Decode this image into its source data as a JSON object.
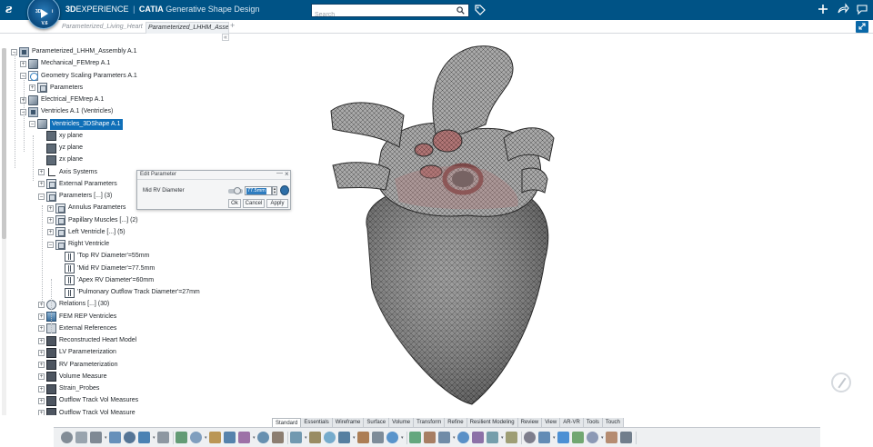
{
  "titlebar": {
    "brand_prefix": "3D",
    "brand_rest": "EXPERIENCE",
    "separator": "|",
    "product": "CATIA",
    "app": "Generative Shape Design",
    "compass_version": "V.6",
    "compass_quadrants": [
      "3D",
      "i"
    ],
    "search_placeholder": "Search",
    "colors": {
      "bar": "#005386",
      "accent": "#0a68a8"
    }
  },
  "tabs": {
    "items": [
      {
        "label": "Parameterized_Living_Heart"
      },
      {
        "label": "Parameterized_LHHM_Assembly"
      }
    ],
    "add_symbol": "+",
    "collapse_symbol": "«"
  },
  "tree": {
    "rows": [
      {
        "label": "Parameterized_LHHM_Assembly A.1",
        "exp": "−",
        "icon": "product-icon"
      },
      {
        "label": "Mechanical_FEMrep A.1",
        "exp": "+",
        "icon": "part-icon"
      },
      {
        "label": "Geometry Scaling Parameters A.1",
        "exp": "−",
        "icon": "geometry-icon"
      },
      {
        "label": "Parameters",
        "exp": "+",
        "icon": "parameters-icon"
      },
      {
        "label": "Electrical_FEMrep A.1",
        "exp": "+",
        "icon": "part-icon"
      },
      {
        "label": "Ventricles A.1 (Ventricles)",
        "exp": "−",
        "icon": "product-icon"
      },
      {
        "label": "Ventricles_3DShape A.1",
        "exp": "−",
        "icon": "part-icon"
      },
      {
        "label": "xy plane",
        "exp": "",
        "icon": "plane-icon"
      },
      {
        "label": "yz plane",
        "exp": "",
        "icon": "plane-icon"
      },
      {
        "label": "zx plane",
        "exp": "",
        "icon": "plane-icon"
      },
      {
        "label": "Axis Systems",
        "exp": "+",
        "icon": "axis-system-icon"
      },
      {
        "label": "External Parameters",
        "exp": "+",
        "icon": "parameters-icon"
      },
      {
        "label": "Parameters [...] (3)",
        "exp": "−",
        "icon": "parameters-icon"
      },
      {
        "label": "Annulus Parameters",
        "exp": "+",
        "icon": "parameters-icon"
      },
      {
        "label": "Papillary Muscles [...] (2)",
        "exp": "+",
        "icon": "parameters-icon"
      },
      {
        "label": "Left Ventricle [...] (5)",
        "exp": "+",
        "icon": "parameters-icon"
      },
      {
        "label": "Right Ventricle",
        "exp": "−",
        "icon": "parameters-icon"
      },
      {
        "label": "'Top RV Diameter'=55mm",
        "exp": "",
        "icon": "formula-parameter-icon"
      },
      {
        "label": "'Mid RV Diameter'=77.5mm",
        "exp": "",
        "icon": "formula-parameter-icon"
      },
      {
        "label": "'Apex RV Diameter'=60mm",
        "exp": "",
        "icon": "formula-parameter-icon"
      },
      {
        "label": "'Pulmonary Outflow Track Diameter'=27mm",
        "exp": "",
        "icon": "formula-parameter-icon"
      },
      {
        "label": "Relations [...] (30)",
        "exp": "+",
        "icon": "relations-icon"
      },
      {
        "label": "FEM REP Ventricles",
        "exp": "+",
        "icon": "fem-icon"
      },
      {
        "label": "External References",
        "exp": "+",
        "icon": "external-references-icon"
      },
      {
        "label": "Reconstructed Heart Model",
        "exp": "+",
        "icon": "body-icon"
      },
      {
        "label": "LV Parameterization",
        "exp": "+",
        "icon": "body-icon"
      },
      {
        "label": "RV Parameterization",
        "exp": "+",
        "icon": "body-icon"
      },
      {
        "label": "Volume Measure",
        "exp": "+",
        "icon": "body-icon"
      },
      {
        "label": "Strain_Probes",
        "exp": "+",
        "icon": "body-icon"
      },
      {
        "label": "Outflow Track Vol Measures",
        "exp": "+",
        "icon": "body-icon"
      },
      {
        "label": "Outflow Track Vol Measure",
        "exp": "+",
        "icon": "body-icon"
      }
    ]
  },
  "dialog": {
    "title": "Edit Parameter",
    "min_symbol": "—",
    "close_symbol": "×",
    "param_label": "Mid RV Diameter",
    "value": "77.5mm",
    "ok": "Ok",
    "cancel": "Cancel",
    "apply": "Apply"
  },
  "actionbar": {
    "tabs": [
      "Standard",
      "Essentials",
      "Wireframe",
      "Surface",
      "Volume",
      "Transform",
      "Refine",
      "Resilient Modeling",
      "Review",
      "View",
      "AR-VR",
      "Tools",
      "Touch"
    ],
    "active_tab": "Standard"
  }
}
